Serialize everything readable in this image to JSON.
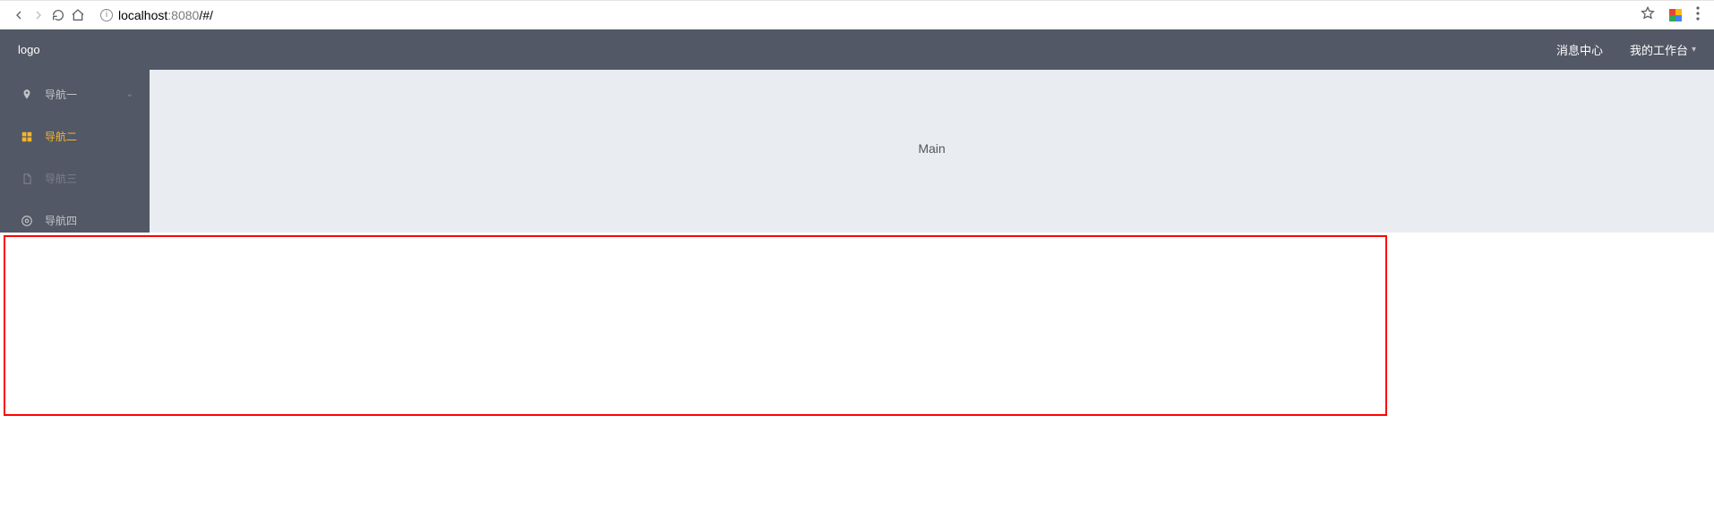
{
  "browser": {
    "url_host": "localhost",
    "url_port": ":8080",
    "url_path": "/#/"
  },
  "header": {
    "logo": "logo",
    "links": {
      "messages": "消息中心",
      "workspace": "我的工作台"
    }
  },
  "sidebar": {
    "items": [
      {
        "label": "导航一"
      },
      {
        "label": "导航二"
      },
      {
        "label": "导航三"
      },
      {
        "label": "导航四"
      }
    ]
  },
  "main": {
    "content": "Main"
  }
}
